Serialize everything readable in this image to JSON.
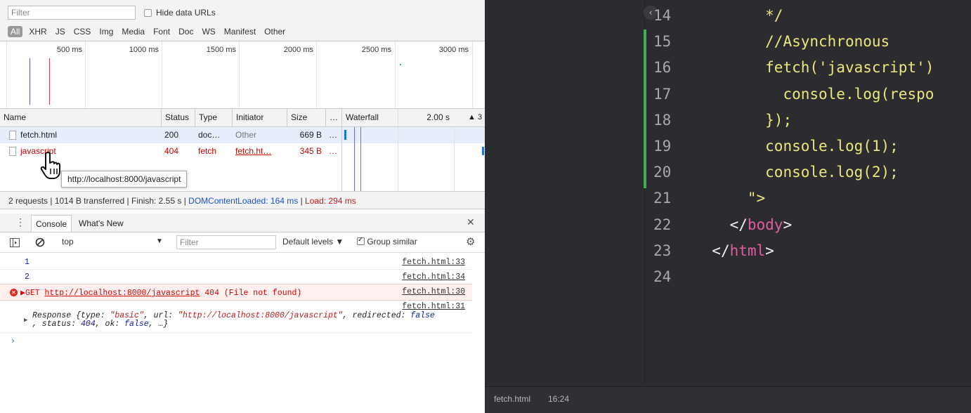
{
  "network": {
    "filter_placeholder": "Filter",
    "hide_data_urls": "Hide data URLs",
    "types": [
      "All",
      "XHR",
      "JS",
      "CSS",
      "Img",
      "Media",
      "Font",
      "Doc",
      "WS",
      "Manifest",
      "Other"
    ],
    "timeline_labels": [
      "500 ms",
      "1000 ms",
      "1500 ms",
      "2000 ms",
      "2500 ms",
      "3000 ms"
    ],
    "columns": [
      "Name",
      "Status",
      "Type",
      "Initiator",
      "Size",
      "…",
      "Waterfall",
      "2.00 s",
      "▲ 3"
    ],
    "rows": [
      {
        "name": "fetch.html",
        "status": "200",
        "type": "doc…",
        "initiator": "Other",
        "size": "669 B",
        "more": "…"
      },
      {
        "name": "javascript",
        "status": "404",
        "type": "fetch",
        "initiator": "fetch.ht…",
        "size": "345 B",
        "more": "…"
      }
    ],
    "tooltip": "http://localhost:8000/javascript",
    "summary_prefix": "2 requests | 1014 B transferred | Finish: 2.55 s | ",
    "summary_dom": "DOMContentLoaded: 164 ms",
    "summary_sep": " | ",
    "summary_load": "Load: 294 ms"
  },
  "drawer": {
    "tabs": [
      "Console",
      "What's New"
    ],
    "context": "top",
    "filter_placeholder": "Filter",
    "levels": "Default levels ▼",
    "group_similar": "Group similar"
  },
  "console": {
    "lines": [
      {
        "msg": "1",
        "src": "fetch.html:33"
      },
      {
        "msg": "2",
        "src": "fetch.html:34"
      }
    ],
    "error": {
      "prefix": "▶GET ",
      "url": "http://localhost:8000/javascript",
      "suffix": " 404 (File not found)",
      "src": "fetch.html:30"
    },
    "response_src": "fetch.html:31"
  },
  "editor": {
    "lines": [
      {
        "num": "14",
        "indent": "        ",
        "parts": [
          [
            "ylw",
            "*/"
          ]
        ]
      },
      {
        "num": "15",
        "indent": "        ",
        "parts": [
          [
            "ylw",
            "//Asynchronous"
          ]
        ]
      },
      {
        "num": "16",
        "indent": "        ",
        "parts": [
          [
            "ylw",
            "fetch('javascript')"
          ]
        ]
      },
      {
        "num": "17",
        "indent": "          ",
        "parts": [
          [
            "ylw",
            "console.log(respo"
          ]
        ]
      },
      {
        "num": "18",
        "indent": "        ",
        "parts": [
          [
            "ylw",
            "});"
          ]
        ]
      },
      {
        "num": "19",
        "indent": "        ",
        "parts": [
          [
            "ylw",
            "console.log(1);"
          ]
        ]
      },
      {
        "num": "20",
        "indent": "        ",
        "parts": [
          [
            "ylw",
            "console.log(2);"
          ]
        ]
      },
      {
        "num": "21",
        "indent": "      ",
        "parts": [
          [
            "ylw",
            "\">"
          ]
        ]
      },
      {
        "num": "22",
        "indent": "    ",
        "parts": [
          [
            "wht",
            "</"
          ],
          [
            "pink",
            "body"
          ],
          [
            "wht",
            ">"
          ]
        ]
      },
      {
        "num": "23",
        "indent": "  ",
        "parts": [
          [
            "wht",
            "</"
          ],
          [
            "pink",
            "html"
          ],
          [
            "wht",
            ">"
          ]
        ]
      },
      {
        "num": "24",
        "indent": "",
        "parts": []
      }
    ],
    "status_file": "fetch.html",
    "status_pos": "16:24"
  },
  "colors": {
    "dom_blue": "#1a4fd8",
    "load_red": "#d01818",
    "git_green": "#3fae54",
    "code_yellow": "#ece77b",
    "tag_pink": "#e05ea0"
  }
}
